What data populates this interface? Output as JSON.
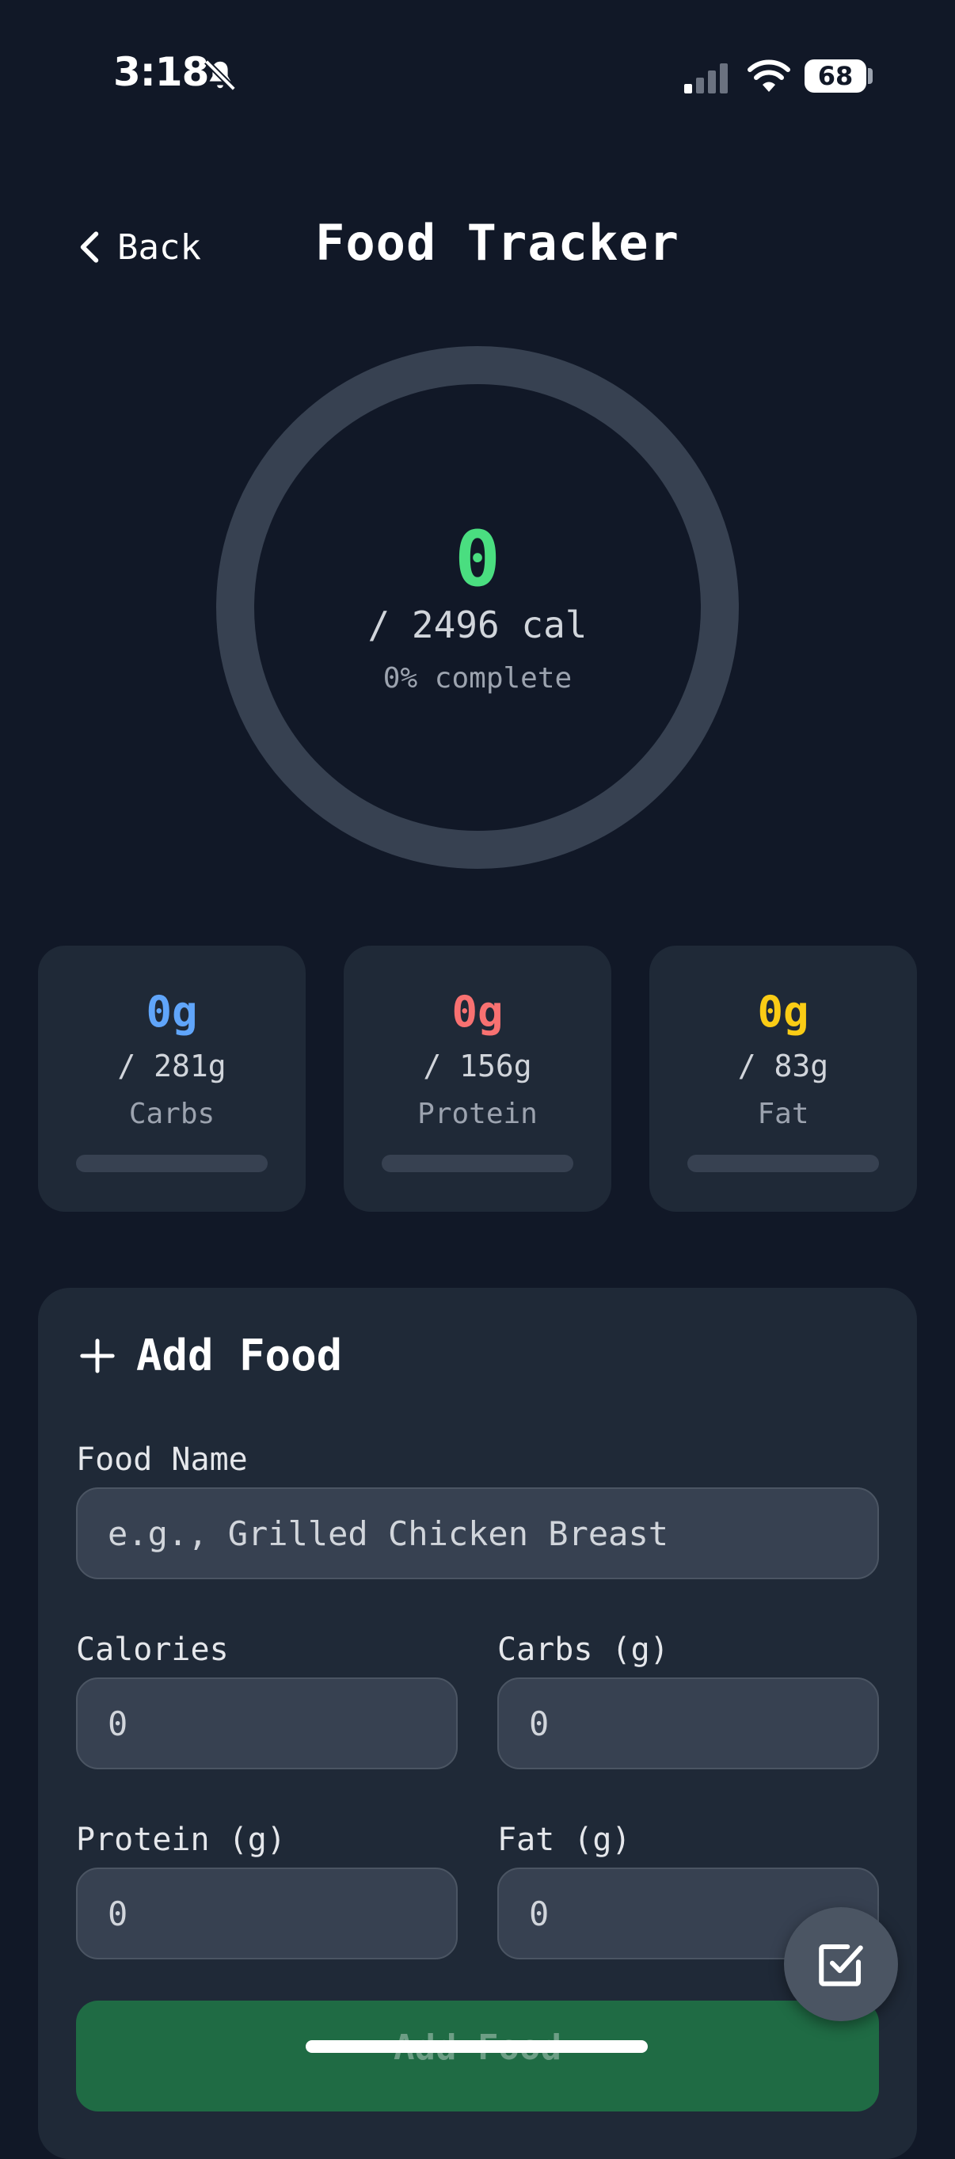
{
  "status_bar": {
    "time": "3:18",
    "battery": "68",
    "icons": [
      "bell-slash-icon",
      "signal-icon",
      "wifi-icon",
      "battery-icon"
    ]
  },
  "header": {
    "back_label": "Back",
    "title": "Food Tracker"
  },
  "calories": {
    "consumed": "0",
    "goal_text": "/ 2496 cal",
    "percent_text": "0% complete",
    "progress": 0,
    "color": "#4ade80"
  },
  "macros": [
    {
      "value": "0g",
      "goal": "/ 281g",
      "label": "Carbs",
      "progress": 0,
      "color": "#60a5fa"
    },
    {
      "value": "0g",
      "goal": "/ 156g",
      "label": "Protein",
      "progress": 0,
      "color": "#f87171"
    },
    {
      "value": "0g",
      "goal": "/ 83g",
      "label": "Fat",
      "progress": 0,
      "color": "#facc15"
    }
  ],
  "add_food": {
    "heading": "Add Food",
    "food_name": {
      "label": "Food Name",
      "placeholder": "e.g., Grilled Chicken Breast",
      "value": ""
    },
    "calories": {
      "label": "Calories",
      "value": "0"
    },
    "carbs": {
      "label": "Carbs (g)",
      "value": "0"
    },
    "protein": {
      "label": "Protein (g)",
      "value": "0"
    },
    "fat": {
      "label": "Fat (g)",
      "value": "0"
    },
    "submit_label": "Add Food"
  },
  "colors": {
    "background": "#111827",
    "card": "#1f2937",
    "submit": "#1f6b44"
  }
}
